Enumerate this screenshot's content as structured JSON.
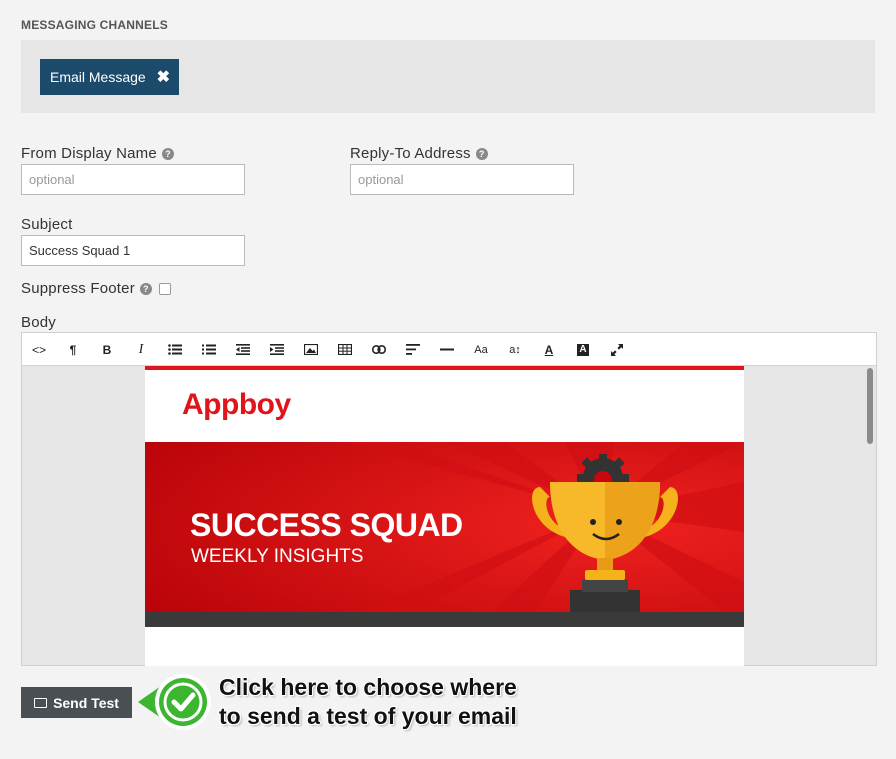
{
  "channels": {
    "section_label": "MESSAGING CHANNELS",
    "selected_channel": "Email Message",
    "remove_symbol": "✖"
  },
  "form": {
    "from_label": "From Display Name",
    "from_placeholder": "optional",
    "reply_label": "Reply-To Address",
    "reply_placeholder": "optional",
    "subject_label": "Subject",
    "subject_value": "Success Squad 1",
    "suppress_label": "Suppress Footer",
    "body_label": "Body",
    "help_glyph": "?"
  },
  "toolbar": {
    "icons": [
      "code-view-icon",
      "paragraph-icon",
      "bold-icon",
      "italic-icon",
      "unordered-list-icon",
      "ordered-list-icon",
      "outdent-icon",
      "indent-icon",
      "image-icon",
      "table-icon",
      "link-icon",
      "align-icon",
      "horizontal-rule-icon",
      "font-size-icon",
      "line-height-icon",
      "font-color-icon",
      "background-color-icon",
      "fullscreen-icon"
    ],
    "code": "<>",
    "paragraph": "¶",
    "bold": "B",
    "italic": "I",
    "font_size": "Aa",
    "line_height": "a↕",
    "font_color": "A",
    "bg_color": "A"
  },
  "email_preview": {
    "logo": "Appboy",
    "hero_title": "SUCCESS SQUAD",
    "hero_subtitle": "WEEKLY INSIGHTS"
  },
  "actions": {
    "send_test": "Send Test"
  },
  "callout": {
    "line1": "Click here to choose where",
    "line2": "to send a test of your email"
  },
  "colors": {
    "brand_red": "#e0151b",
    "chip_blue": "#1b4a6b",
    "button_gray": "#4a4f54",
    "callout_green": "#3cb531"
  }
}
